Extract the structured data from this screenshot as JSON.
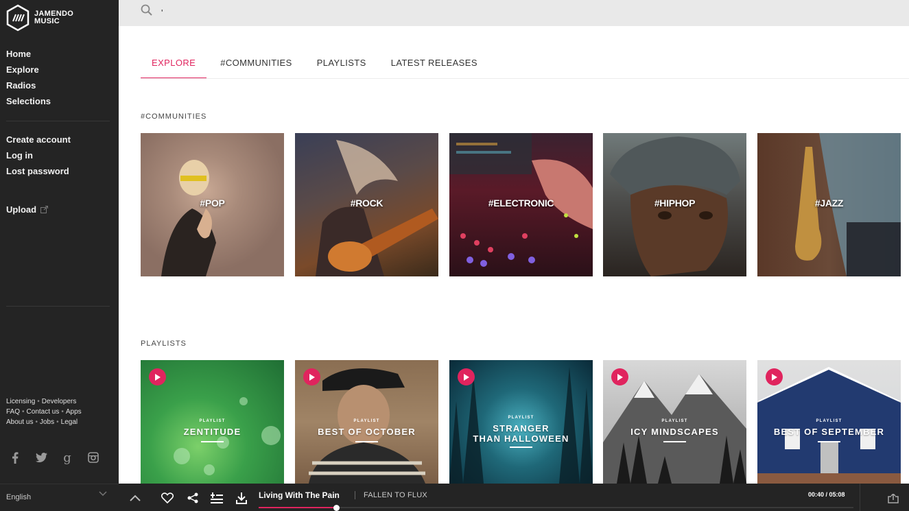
{
  "brand": {
    "line1": "JAMENDO",
    "line2": "MUSIC"
  },
  "sidebar": {
    "nav": [
      "Home",
      "Explore",
      "Radios",
      "Selections"
    ],
    "account": [
      "Create account",
      "Log in",
      "Lost password"
    ],
    "upload": "Upload",
    "footer": {
      "row1": [
        "Licensing",
        "Developers"
      ],
      "row2": [
        "FAQ",
        "Contact us",
        "Apps"
      ],
      "row3": [
        "About us",
        "Jobs",
        "Legal"
      ]
    },
    "social_icons": [
      "facebook-icon",
      "twitter-icon",
      "google-plus-icon",
      "instagram-icon"
    ],
    "language": "English"
  },
  "search": {
    "value": "'",
    "placeholder": ""
  },
  "tabs": [
    {
      "label": "EXPLORE",
      "active": true
    },
    {
      "label": "#COMMUNITIES",
      "active": false
    },
    {
      "label": "PLAYLISTS",
      "active": false
    },
    {
      "label": "LATEST RELEASES",
      "active": false
    }
  ],
  "communities": {
    "title": "#COMMUNITIES",
    "items": [
      "#POP",
      "#ROCK",
      "#ELECTRONIC",
      "#HIPHOP",
      "#JAZZ"
    ]
  },
  "playlists": {
    "title": "PLAYLISTS",
    "small_label": "PLAYLIST",
    "items": [
      {
        "line1": "ZENTITUDE",
        "line2": ""
      },
      {
        "line1": "BEST OF OCTOBER",
        "line2": ""
      },
      {
        "line1": "STRANGER",
        "line2": "THAN HALLOWEEN"
      },
      {
        "line1": "ICY MINDSCAPES",
        "line2": ""
      },
      {
        "line1": "BEST OF SEPTEMBER",
        "line2": ""
      }
    ]
  },
  "player": {
    "track": "Living With The Pain",
    "artist": "FALLEN TO FLUX",
    "time": "00:40 / 05:08",
    "progress": 0.13
  },
  "colors": {
    "accent": "#e0245e",
    "sidebar": "#242424"
  }
}
